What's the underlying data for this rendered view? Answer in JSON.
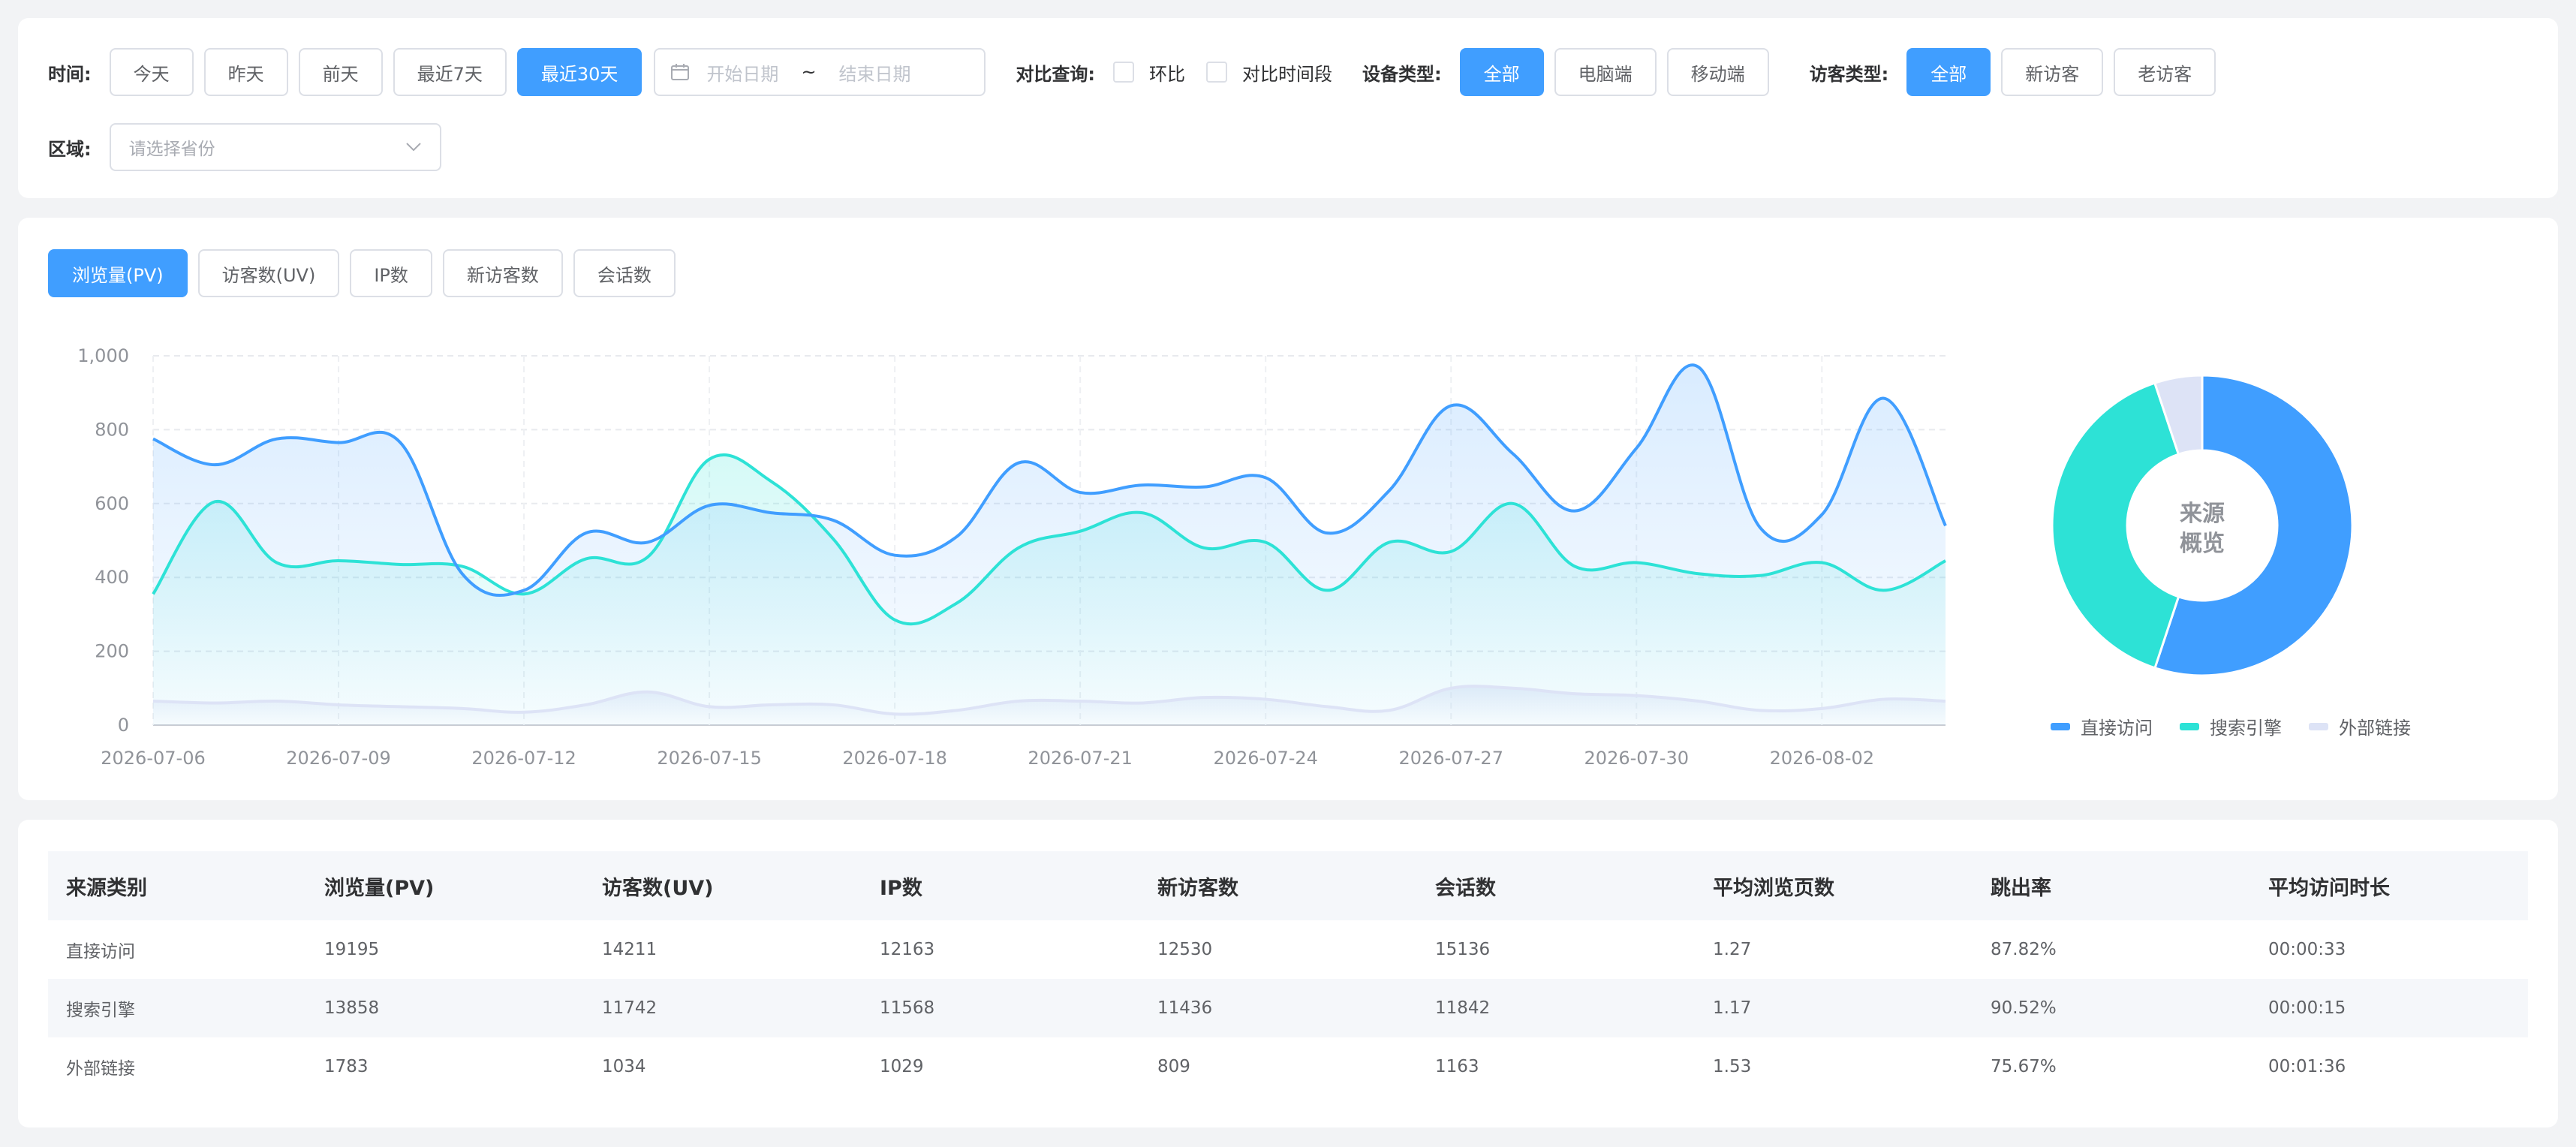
{
  "filters": {
    "time_label": "时间:",
    "time_buttons": [
      "今天",
      "昨天",
      "前天",
      "最近7天",
      "最近30天"
    ],
    "time_active": "最近30天",
    "date_start_placeholder": "开始日期",
    "date_sep": "~",
    "date_end_placeholder": "结束日期",
    "compare_label": "对比查询:",
    "compare_options": [
      "环比",
      "对比时间段"
    ],
    "device_label": "设备类型:",
    "device_buttons": [
      "全部",
      "电脑端",
      "移动端"
    ],
    "device_active": "全部",
    "visitor_label": "访客类型:",
    "visitor_buttons": [
      "全部",
      "新访客",
      "老访客"
    ],
    "visitor_active": "全部",
    "region_label": "区域:",
    "region_placeholder": "请选择省份"
  },
  "metric_tabs": [
    "浏览量(PV)",
    "访客数(UV)",
    "IP数",
    "新访客数",
    "会话数"
  ],
  "metric_active": "浏览量(PV)",
  "colors": {
    "primary": "#409eff",
    "direct": "#409eff",
    "search": "#2de2d6",
    "external": "#dde3f6"
  },
  "chart_data": [
    {
      "type": "area",
      "x": [
        "2026-07-06",
        "2026-07-07",
        "2026-07-08",
        "2026-07-09",
        "2026-07-10",
        "2026-07-11",
        "2026-07-12",
        "2026-07-13",
        "2026-07-14",
        "2026-07-15",
        "2026-07-16",
        "2026-07-17",
        "2026-07-18",
        "2026-07-19",
        "2026-07-20",
        "2026-07-21",
        "2026-07-22",
        "2026-07-23",
        "2026-07-24",
        "2026-07-25",
        "2026-07-26",
        "2026-07-27",
        "2026-07-28",
        "2026-07-29",
        "2026-07-30",
        "2026-07-31",
        "2026-08-01",
        "2026-08-02",
        "2026-08-03",
        "2026-08-04"
      ],
      "x_ticks": [
        "2026-07-06",
        "2026-07-09",
        "2026-07-12",
        "2026-07-15",
        "2026-07-18",
        "2026-07-21",
        "2026-07-24",
        "2026-07-27",
        "2026-07-30",
        "2026-08-02"
      ],
      "ylim": [
        0,
        1000
      ],
      "y_ticks": [
        "0",
        "200",
        "400",
        "600",
        "800",
        "1,000"
      ],
      "grid": true,
      "series": [
        {
          "name": "直接访问",
          "color": "#409eff",
          "values": [
            775,
            705,
            775,
            765,
            765,
            410,
            365,
            520,
            495,
            595,
            575,
            555,
            460,
            510,
            710,
            630,
            650,
            645,
            670,
            520,
            635,
            865,
            735,
            580,
            750,
            970,
            535,
            570,
            885,
            540
          ]
        },
        {
          "name": "搜索引擎",
          "color": "#2de2d6",
          "values": [
            355,
            605,
            440,
            445,
            435,
            430,
            355,
            450,
            455,
            720,
            660,
            505,
            285,
            330,
            480,
            525,
            575,
            480,
            495,
            365,
            495,
            470,
            600,
            430,
            440,
            410,
            405,
            440,
            365,
            445
          ]
        },
        {
          "name": "外部链接",
          "color": "#dde3f6",
          "values": [
            65,
            60,
            65,
            55,
            50,
            45,
            35,
            55,
            90,
            50,
            55,
            55,
            30,
            40,
            65,
            65,
            60,
            75,
            70,
            50,
            40,
            100,
            100,
            85,
            80,
            65,
            40,
            45,
            70,
            65
          ]
        }
      ]
    },
    {
      "type": "pie",
      "center_label": "来源\n概览",
      "center_line1": "来源",
      "center_line2": "概览",
      "categories": [
        "直接访问",
        "搜索引擎",
        "外部链接"
      ],
      "values": [
        19195,
        13858,
        1783
      ],
      "colors": [
        "#409eff",
        "#2de2d6",
        "#dde3f6"
      ],
      "legend": "bottom"
    }
  ],
  "table": {
    "headers": [
      "来源类别",
      "浏览量(PV)",
      "访客数(UV)",
      "IP数",
      "新访客数",
      "会话数",
      "平均浏览页数",
      "跳出率",
      "平均访问时长"
    ],
    "rows": [
      [
        "直接访问",
        "19195",
        "14211",
        "12163",
        "12530",
        "15136",
        "1.27",
        "87.82%",
        "00:00:33"
      ],
      [
        "搜索引擎",
        "13858",
        "11742",
        "11568",
        "11436",
        "11842",
        "1.17",
        "90.52%",
        "00:00:15"
      ],
      [
        "外部链接",
        "1783",
        "1034",
        "1029",
        "809",
        "1163",
        "1.53",
        "75.67%",
        "00:01:36"
      ]
    ]
  }
}
